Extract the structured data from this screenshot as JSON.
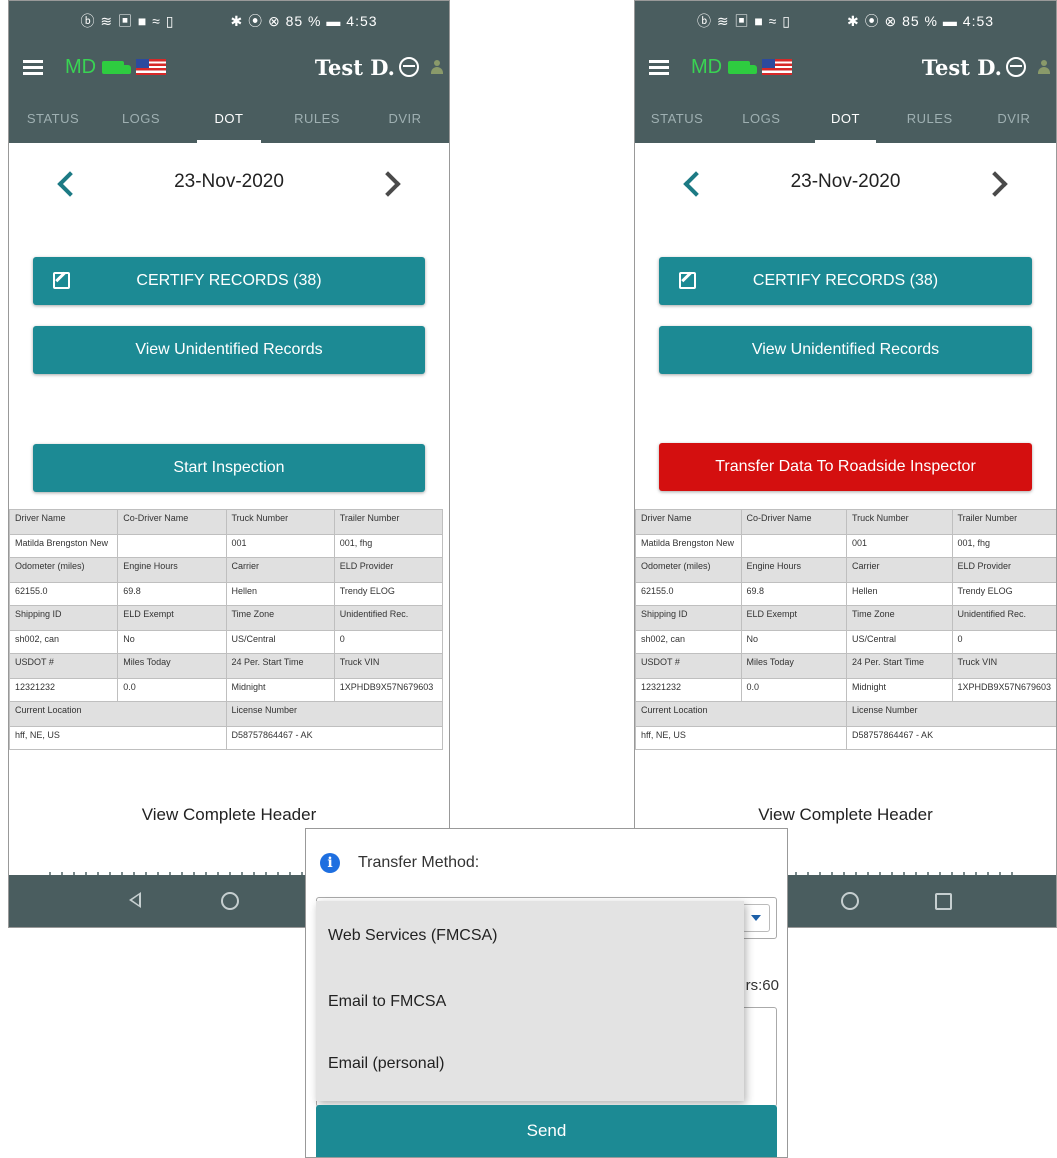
{
  "status_bar": {
    "left": "ⓑ ≋ ▣ ■ ≈ ▯",
    "right": "✱ ⦿ ⊗ 85 % ▬ 4:53"
  },
  "app_bar": {
    "md": "MD",
    "user": "Test D."
  },
  "tabs": [
    "STATUS",
    "LOGS",
    "DOT",
    "RULES",
    "DVIR"
  ],
  "active_tab": "DOT",
  "date": "23-Nov-2020",
  "buttons": {
    "certify": "CERTIFY RECORDS (38)",
    "unidentified": "View Unidentified Records",
    "start_inspection": "Start Inspection",
    "transfer": "Transfer Data To Roadside Inspector"
  },
  "header_table": {
    "labels_1": [
      "Driver Name",
      "Co-Driver Name",
      "Truck Number",
      "Trailer Number"
    ],
    "values_1": [
      "Matilda Brengston New",
      "",
      "001",
      "001, fhg"
    ],
    "labels_2": [
      "Odometer (miles)",
      "Engine Hours",
      "Carrier",
      "ELD Provider"
    ],
    "values_2": [
      "62155.0",
      "69.8",
      "Hellen",
      "Trendy ELOG"
    ],
    "labels_3": [
      "Shipping ID",
      "ELD Exempt",
      "Time Zone",
      "Unidentified Rec."
    ],
    "values_3": [
      "sh002, can",
      "No",
      "US/Central",
      "0"
    ],
    "labels_4": [
      "USDOT #",
      "Miles Today",
      "24 Per. Start Time",
      "Truck VIN"
    ],
    "values_4": [
      "12321232",
      "0.0",
      "Midnight",
      "1XPHDB9X57N679603"
    ],
    "labels_5": [
      "Current Location",
      "License Number"
    ],
    "values_5": [
      "hff, NE, US",
      "D58757864467 - AK"
    ]
  },
  "view_complete_header": "View Complete Header",
  "dialog": {
    "title": "Transfer Method:",
    "info_icon": "i",
    "options": [
      "Web Services (FMCSA)",
      "Email to FMCSA",
      "Email (personal)"
    ],
    "chars_label": "rs:60",
    "send": "Send"
  },
  "colors": {
    "teal": "#1c8a94",
    "header": "#4a5d5f",
    "red": "#d40f0f"
  }
}
